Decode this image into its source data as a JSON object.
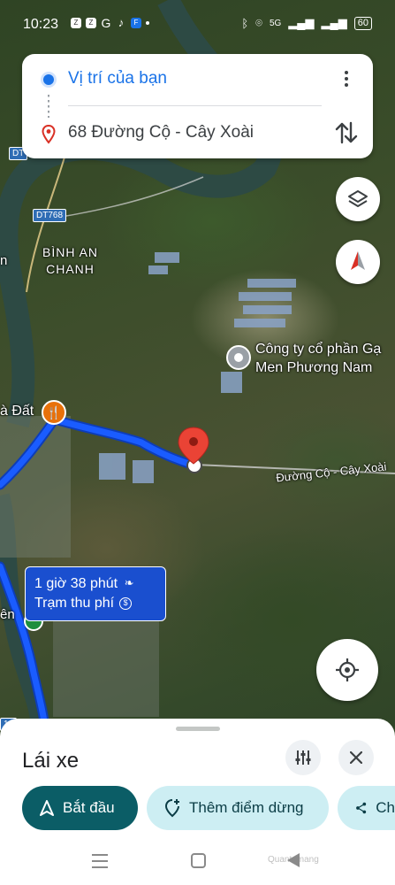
{
  "status_bar": {
    "time": "10:23",
    "network": "5G",
    "battery": "60",
    "left_icons": [
      "zalo-icon",
      "zalo-icon",
      "google-icon",
      "tiktok-icon",
      "app-icon",
      "dot-icon"
    ],
    "right_icons": [
      "bluetooth-icon",
      "location-icon",
      "signal-icon",
      "wifi-icon",
      "battery-icon"
    ]
  },
  "directions": {
    "origin": "Vị trí của bạn",
    "destination": "68 Đường Cộ - Cây Xoài",
    "colors": {
      "origin": "#1a73e8",
      "destination_pin": "#d93025"
    }
  },
  "map": {
    "labels": {
      "area": "BÌNH AN\nCHANH",
      "company_line1": "Công ty cổ phần Gạ",
      "company_line2": "Men Phương Nam",
      "food_place": "à Đất",
      "road": "Đường Cộ - Cây Xoài",
      "badge_1": "DT",
      "badge_2": "DT768",
      "badge_3": "16",
      "left_edge": "n",
      "left_edge_2": "ên"
    },
    "route_color": "#1a5cff"
  },
  "route_info": {
    "duration": "1 giờ 38 phút",
    "toll": "Trạm thu phí"
  },
  "sheet": {
    "title": "Lái xe",
    "start_label": "Bắt đầu",
    "add_stop_label": "Thêm điểm dừng",
    "share_label": "Ch"
  },
  "navbar": {
    "watermark": "Quantrimang"
  }
}
